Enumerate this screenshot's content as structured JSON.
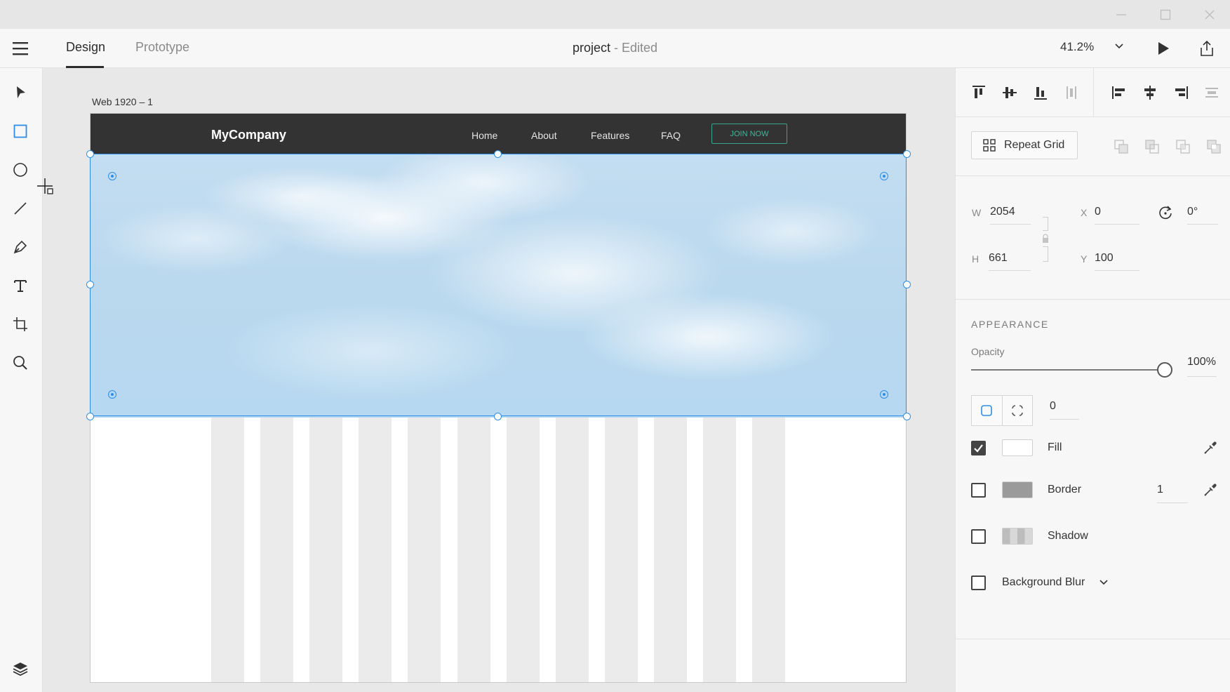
{
  "window": {
    "minimize_icon": "minimize-icon",
    "maximize_icon": "maximize-icon",
    "close_icon": "close-icon"
  },
  "appbar": {
    "tabs": [
      {
        "label": "Design",
        "active": true
      },
      {
        "label": "Prototype",
        "active": false
      }
    ],
    "doc_name": "project",
    "doc_status": "- Edited",
    "zoom": "41.2%"
  },
  "tools": [
    "select-icon",
    "rectangle-icon",
    "ellipse-icon",
    "line-icon",
    "pen-icon",
    "text-icon",
    "artboard-icon",
    "zoom-icon",
    "layers-icon"
  ],
  "artboard": {
    "label": "Web 1920 – 1",
    "site": {
      "logo": "MyCompany",
      "links": [
        "Home",
        "About",
        "Features",
        "FAQ"
      ],
      "cta": "JOIN NOW",
      "cta_color": "#3fb89d",
      "nav_bg": "#333333"
    }
  },
  "selection_color": "#2d8ee8",
  "panel": {
    "repeat_grid_label": "Repeat Grid",
    "geometry": {
      "w_label": "W",
      "w": "2054",
      "h_label": "H",
      "h": "661",
      "x_label": "X",
      "x": "0",
      "y_label": "Y",
      "y": "100",
      "rotation": "0°"
    },
    "appearance": {
      "title": "APPEARANCE",
      "opacity_label": "Opacity",
      "opacity_value": "100%",
      "opacity": 1.0,
      "corner_radius": "0",
      "fill": {
        "label": "Fill",
        "checked": true,
        "color": "#ffffff"
      },
      "border": {
        "label": "Border",
        "checked": false,
        "color": "#9a9a9a",
        "width": "1"
      },
      "shadow": {
        "label": "Shadow",
        "checked": false
      },
      "background_blur": {
        "label": "Background Blur",
        "checked": false
      }
    }
  }
}
